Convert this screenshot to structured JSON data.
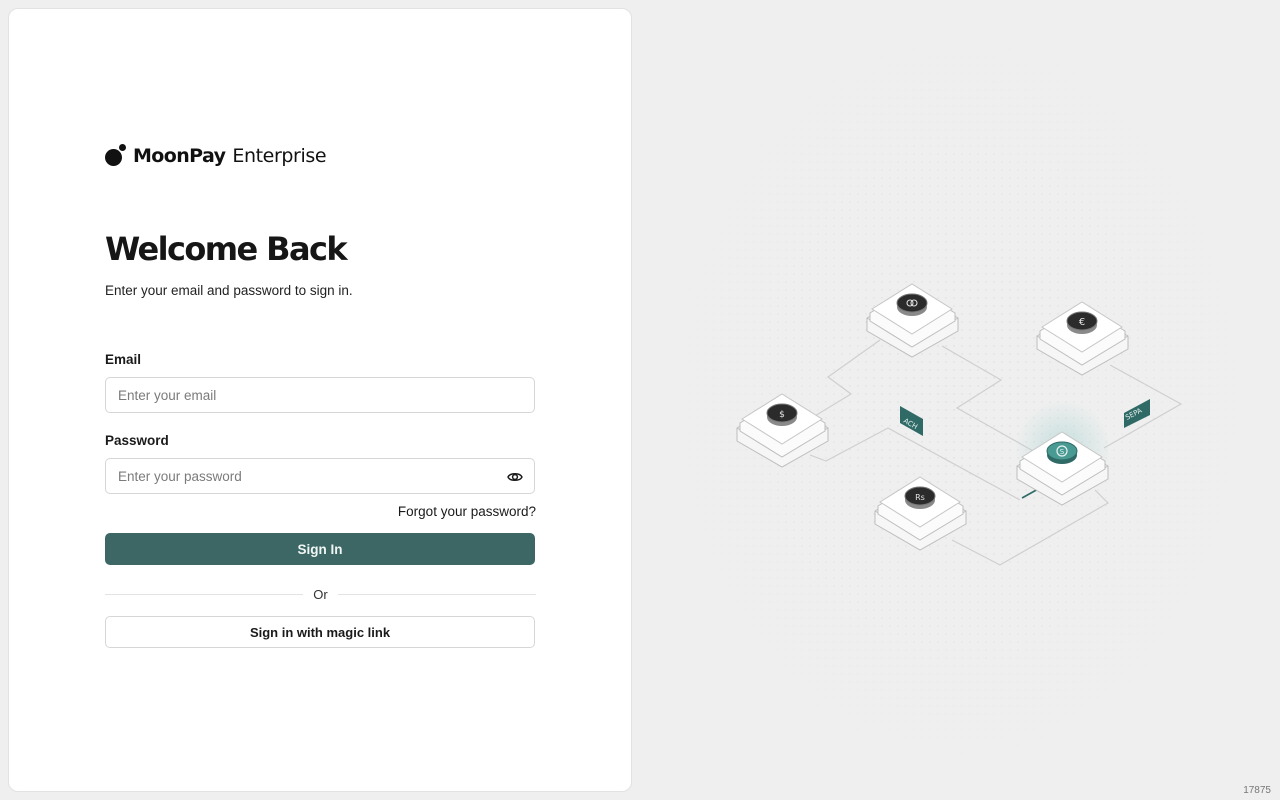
{
  "brand": {
    "name": "MoonPay",
    "product": "Enterprise"
  },
  "login": {
    "title": "Welcome Back",
    "subtitle": "Enter your email and password to sign in.",
    "email_label": "Email",
    "email_placeholder": "Enter your email",
    "email_value": "",
    "password_label": "Password",
    "password_placeholder": "Enter your password",
    "password_value": "",
    "forgot_link": "Forgot your password?",
    "sign_in_button": "Sign In",
    "divider_text": "Or",
    "magic_link_button": "Sign in with magic link"
  },
  "illustration": {
    "tags": [
      "ACH",
      "SEPA"
    ],
    "nodes": [
      "mastercard-coin",
      "euro-coin",
      "dollar-coin",
      "stablecoin-coin",
      "rupee-coin"
    ]
  },
  "footer": {
    "build_number": "17875"
  },
  "colors": {
    "primary": "#3c6765",
    "background": "#efefef",
    "tag": "#2f6a66",
    "accent_teal": "#4a9a94"
  }
}
